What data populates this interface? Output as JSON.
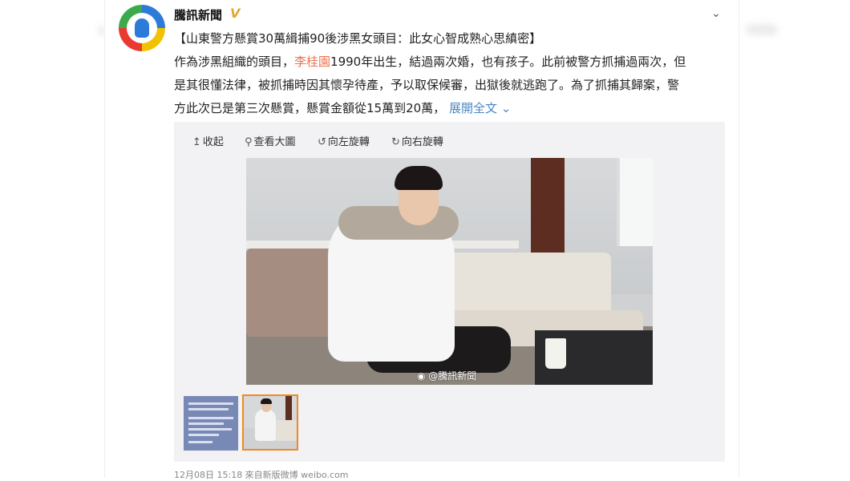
{
  "post": {
    "author": "騰訊新聞",
    "verified_badge": "V",
    "headline": "【山東警方懸賞30萬緝捕90後涉黑女頭目：此女心智成熟心思縝密】",
    "body": {
      "line1_pre": "作為涉黑組織的頭目，",
      "name": "李桂園",
      "line1_post": "1990年出生，結過兩次婚，也有孩子。此前被警方抓捕過兩次，但",
      "line2": "是其很懂法律，被抓捕時因其懷孕待產，予以取保候審，出獄後就逃跑了。為了抓捕其歸案，警",
      "line3": "方此次已是第三次懸賞，懸賞金額從15萬到20萬，",
      "expand": "展開全文"
    },
    "footer": "12月08日 15:18  來自新版微博 weibo.com"
  },
  "toolbar": {
    "collapse": "收起",
    "view_large": "查看大圖",
    "rotate_left": "向左旋轉",
    "rotate_right": "向右旋轉"
  },
  "media": {
    "watermark": "@騰訊新聞"
  },
  "icons": {
    "collapse": "arrow-up-icon",
    "view_large": "magnifier-icon",
    "rotate_left": "rotate-left-icon",
    "rotate_right": "rotate-right-icon",
    "menu": "chevron-down-icon"
  },
  "colors": {
    "name_highlight": "#eb7350",
    "link": "#4b86c4",
    "badge": "#e7a32b",
    "thumb_selected": "#f08a24"
  }
}
